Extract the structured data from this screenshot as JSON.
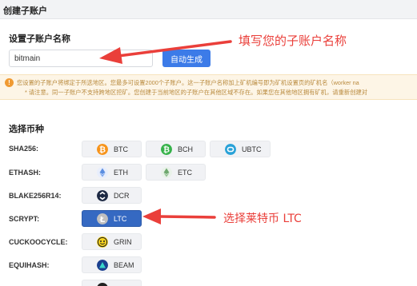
{
  "header": {
    "title": "创建子账户"
  },
  "name_section": {
    "title": "设置子账户名称",
    "input_value": "bitmain",
    "auto_button_label": "自动生成",
    "annotation": "填写您的子账户名称"
  },
  "notice": {
    "icon": "warning-icon",
    "line1": "您设置的子账户将绑定于所选地区。您最多可设置2000个子账户。这一子账户名称加上矿机编号即为矿机设置页的矿机名（worker na",
    "line2": "* 请注意。同一子账户不支持跨地区挖矿。您创建于当前地区的子账户在其他区域不存在。如果您在其他地区拥有矿机，请重新创建对"
  },
  "coin_section": {
    "title": "选择币种",
    "annotation": "选择莱特币 LTC",
    "selected": "LTC",
    "rows": [
      {
        "algo": "SHA256:",
        "coins": [
          {
            "label": "BTC",
            "icon": "bitcoin-icon",
            "color": "#f7931a"
          },
          {
            "label": "BCH",
            "icon": "bitcoin-cash-icon",
            "color": "#36b24a"
          },
          {
            "label": "UBTC",
            "icon": "ubtc-icon",
            "color": "#2aa2d8"
          }
        ]
      },
      {
        "algo": "ETHASH:",
        "coins": [
          {
            "label": "ETH",
            "icon": "ethereum-icon",
            "color": "#5b8ee0"
          },
          {
            "label": "ETC",
            "icon": "ethereum-classic-icon",
            "color": "#6ea86e"
          }
        ]
      },
      {
        "algo": "BLAKE256R14:",
        "coins": [
          {
            "label": "DCR",
            "icon": "decred-icon",
            "color": "#1e2a44"
          }
        ]
      },
      {
        "algo": "SCRYPT:",
        "coins": [
          {
            "label": "LTC",
            "icon": "litecoin-icon",
            "color": "#bfbfbf"
          }
        ]
      },
      {
        "algo": "CUCKOOCYCLE:",
        "coins": [
          {
            "label": "GRIN",
            "icon": "grin-icon",
            "color": "#f6d21c"
          }
        ]
      },
      {
        "algo": "EQUIHASH:",
        "coins": [
          {
            "label": "BEAM",
            "icon": "beam-icon",
            "color": "#1b3f8f"
          }
        ]
      }
    ]
  },
  "colors": {
    "accent": "#3c7be8",
    "selected": "#3569c2",
    "annotation": "#ea3f3a",
    "notice_bg": "#fdf5e6"
  }
}
